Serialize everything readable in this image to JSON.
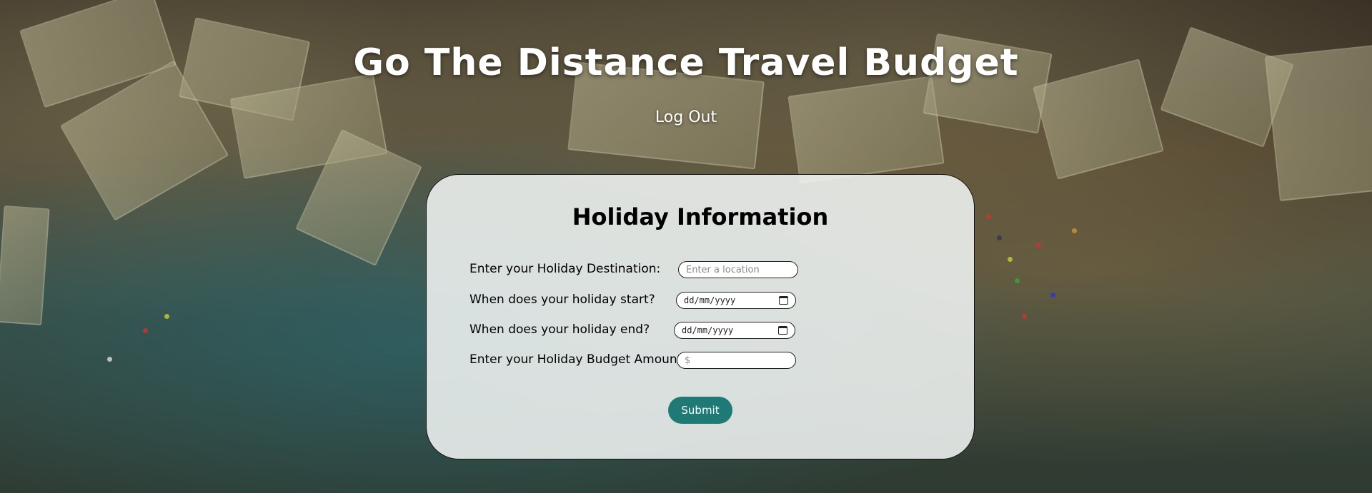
{
  "header": {
    "title": "Go The Distance Travel Budget",
    "logout_label": "Log Out"
  },
  "form": {
    "title": "Holiday Information",
    "destination": {
      "label": "Enter your Holiday Destination:",
      "placeholder": "Enter a location",
      "value": ""
    },
    "start_date": {
      "label": "When does your holiday start?",
      "display": "dd/mm/yyyy",
      "icon": "calendar-icon"
    },
    "end_date": {
      "label": "When does your holiday end?",
      "display": "dd/mm/yyyy",
      "icon": "calendar-icon"
    },
    "budget": {
      "label": "Enter your Holiday Budget Amount:",
      "placeholder": "$",
      "value": ""
    },
    "submit_label": "Submit"
  },
  "colors": {
    "accent": "#1f7a76",
    "title_text": "#ffffff",
    "card_bg": "#f0f4f2"
  }
}
